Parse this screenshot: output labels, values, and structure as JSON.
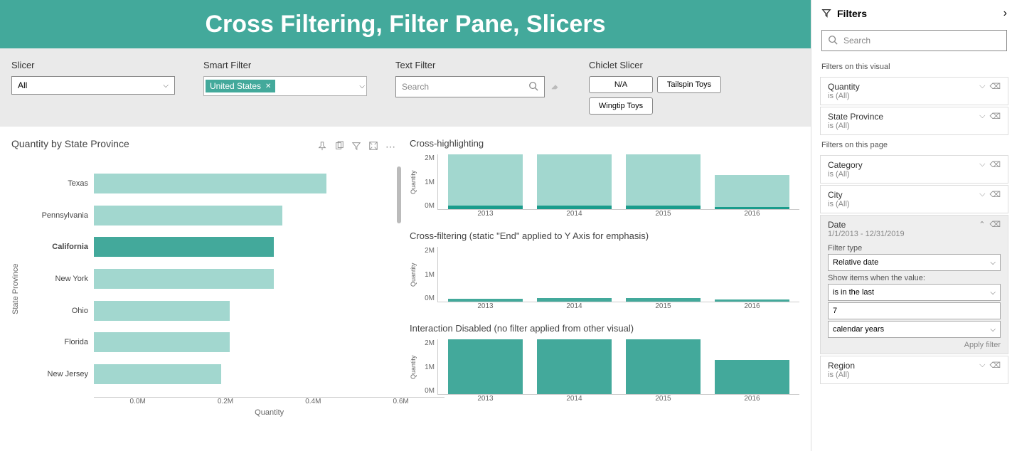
{
  "title": "Cross Filtering, Filter Pane, Slicers",
  "controls": {
    "slicer": {
      "label": "Slicer",
      "value": "All"
    },
    "smart_filter": {
      "label": "Smart Filter",
      "chip": "United States"
    },
    "text_filter": {
      "label": "Text Filter",
      "placeholder": "Search"
    },
    "chiclet": {
      "label": "Chiclet Slicer",
      "items": [
        "N/A",
        "Tailspin Toys",
        "Wingtip Toys"
      ]
    }
  },
  "filter_pane": {
    "header": "Filters",
    "search_placeholder": "Search",
    "visual_label": "Filters on this visual",
    "visual_cards": [
      {
        "title": "Quantity",
        "sub": "is (All)"
      },
      {
        "title": "State Province",
        "sub": "is (All)"
      }
    ],
    "page_label": "Filters on this page",
    "page_cards": [
      {
        "title": "Category",
        "sub": "is (All)"
      },
      {
        "title": "City",
        "sub": "is (All)"
      }
    ],
    "date_card": {
      "title": "Date",
      "sub": "1/1/2013 - 12/31/2019",
      "filter_type_label": "Filter type",
      "filter_type_value": "Relative date",
      "show_label": "Show items when the value:",
      "op_value": "is in the last",
      "num_value": "7",
      "unit_value": "calendar years",
      "apply_label": "Apply filter"
    },
    "region_card": {
      "title": "Region",
      "sub": "is (All)"
    }
  },
  "chart_data": [
    {
      "id": "hbar",
      "type": "bar",
      "orientation": "horizontal",
      "title": "Quantity by State Province",
      "xlabel": "Quantity",
      "ylabel": "State Province",
      "xlim": [
        0,
        0.6
      ],
      "x_ticks": [
        "0.0M",
        "0.2M",
        "0.4M",
        "0.6M"
      ],
      "selected": "California",
      "categories": [
        "Texas",
        "Pennsylvania",
        "California",
        "New York",
        "Ohio",
        "Florida",
        "New Jersey"
      ],
      "values": [
        0.53,
        0.43,
        0.41,
        0.41,
        0.31,
        0.31,
        0.29
      ]
    },
    {
      "id": "cross_hl",
      "type": "bar",
      "title": "Cross-highlighting",
      "ylabel": "Quantity",
      "ylim": [
        0,
        2
      ],
      "y_ticks": [
        "2M",
        "1M",
        "0M"
      ],
      "categories": [
        "2013",
        "2014",
        "2015",
        "2016"
      ],
      "series": [
        {
          "name": "total",
          "values": [
            2.1,
            2.25,
            2.25,
            1.25
          ]
        },
        {
          "name": "highlighted",
          "values": [
            0.13,
            0.14,
            0.14,
            0.08
          ]
        }
      ]
    },
    {
      "id": "cross_filt",
      "type": "bar",
      "title": "Cross-filtering (static \"End\" applied to Y Axis for emphasis)",
      "ylabel": "Quantity",
      "ylim": [
        0,
        2
      ],
      "y_ticks": [
        "2M",
        "1M",
        "0M"
      ],
      "categories": [
        "2013",
        "2014",
        "2015",
        "2016"
      ],
      "values": [
        0.11,
        0.12,
        0.12,
        0.07
      ]
    },
    {
      "id": "no_interact",
      "type": "bar",
      "title": "Interaction Disabled (no filter applied from other visual)",
      "ylabel": "Quantity",
      "ylim": [
        0,
        2
      ],
      "y_ticks": [
        "2M",
        "1M",
        "0M"
      ],
      "categories": [
        "2013",
        "2014",
        "2015",
        "2016"
      ],
      "values": [
        2.1,
        2.25,
        2.25,
        1.25
      ]
    }
  ]
}
